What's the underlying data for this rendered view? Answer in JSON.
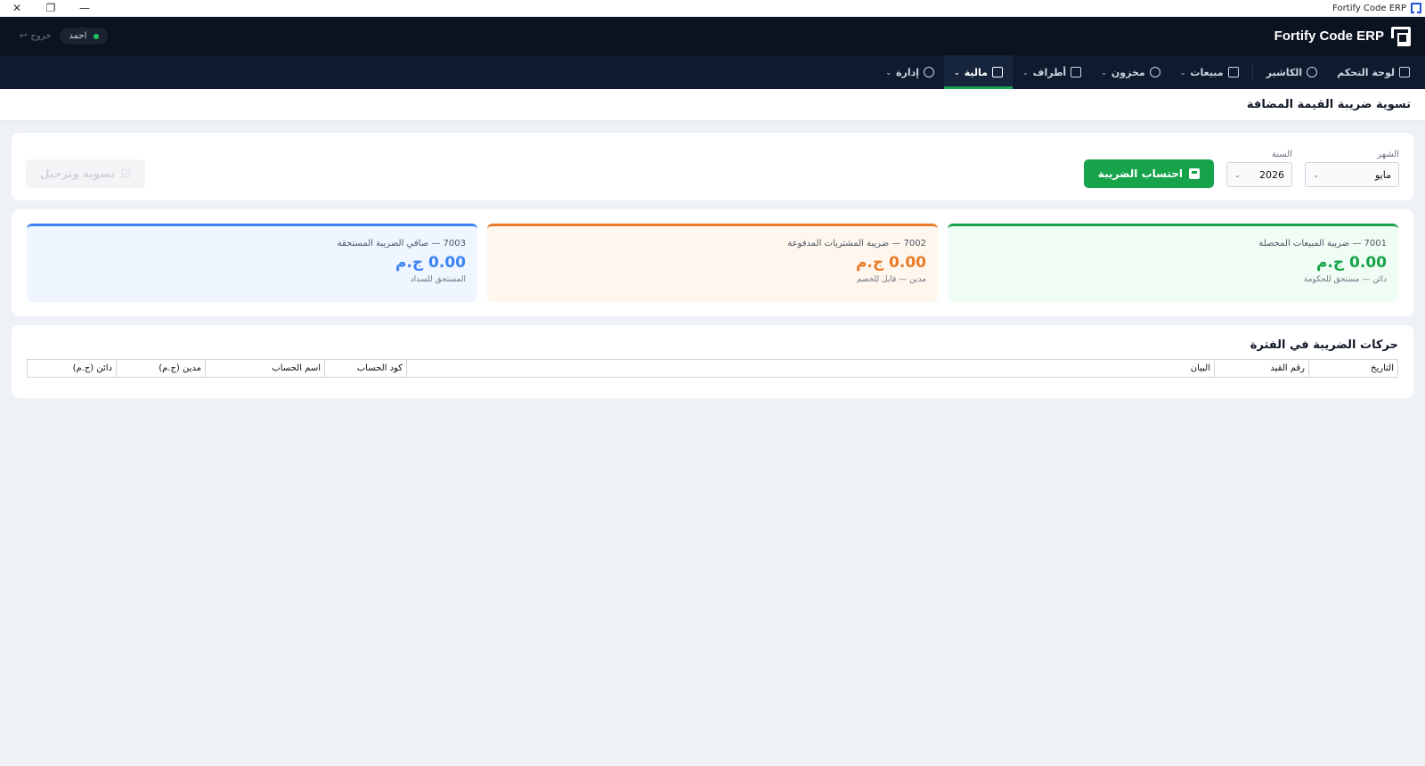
{
  "window": {
    "title": "Fortify Code ERP"
  },
  "header": {
    "brand": "Fortify Code ERP",
    "user_name": "احمد",
    "logout_label": "خروج"
  },
  "nav": {
    "items": [
      {
        "label": "لوحة التحكم",
        "icon": "dashboard-icon",
        "has_dropdown": false
      },
      {
        "label": "الكاشير",
        "icon": "cashier-icon",
        "has_dropdown": false
      },
      {
        "label": "مبيعات",
        "icon": "receipt-icon",
        "has_dropdown": true
      },
      {
        "label": "مخزون",
        "icon": "box-icon",
        "has_dropdown": true
      },
      {
        "label": "أطراف",
        "icon": "people-icon",
        "has_dropdown": true
      },
      {
        "label": "مالية",
        "icon": "calculator-icon",
        "has_dropdown": true,
        "active": true
      },
      {
        "label": "إدارة",
        "icon": "gear-icon",
        "has_dropdown": true
      }
    ]
  },
  "page": {
    "title": "تسوية ضريبة القيمة المضافة"
  },
  "filters": {
    "month_label": "الشهر",
    "month_value": "مايو",
    "year_label": "السنة",
    "year_value": "2026",
    "calculate_button": "احتساب الضريبة",
    "settle_button": "تسوية وترحيل"
  },
  "kpis": [
    {
      "title": "7001 — ضريبة المبيعات المحصلة",
      "value": "0.00 ج.م",
      "sub": "دائن — مستحق للحكومة",
      "color": "#16a34a"
    },
    {
      "title": "7002 — ضريبة المشتريات المدفوعة",
      "value": "0.00 ج.م",
      "sub": "مدين — قابل للخصم",
      "color": "#ea7a29"
    },
    {
      "title": "7003 — صافي الضريبة المستحقة",
      "value": "0.00 ج.م",
      "sub": "المستحق للسداد",
      "color": "#3b82f6"
    }
  ],
  "transactions": {
    "title": "حركات الضريبة في الفترة",
    "columns": [
      "التاريخ",
      "رقم القيد",
      "البيان",
      "كود الحساب",
      "اسم الحساب",
      "مدين (ج.م)",
      "دائن (ج.م)"
    ],
    "rows": []
  }
}
